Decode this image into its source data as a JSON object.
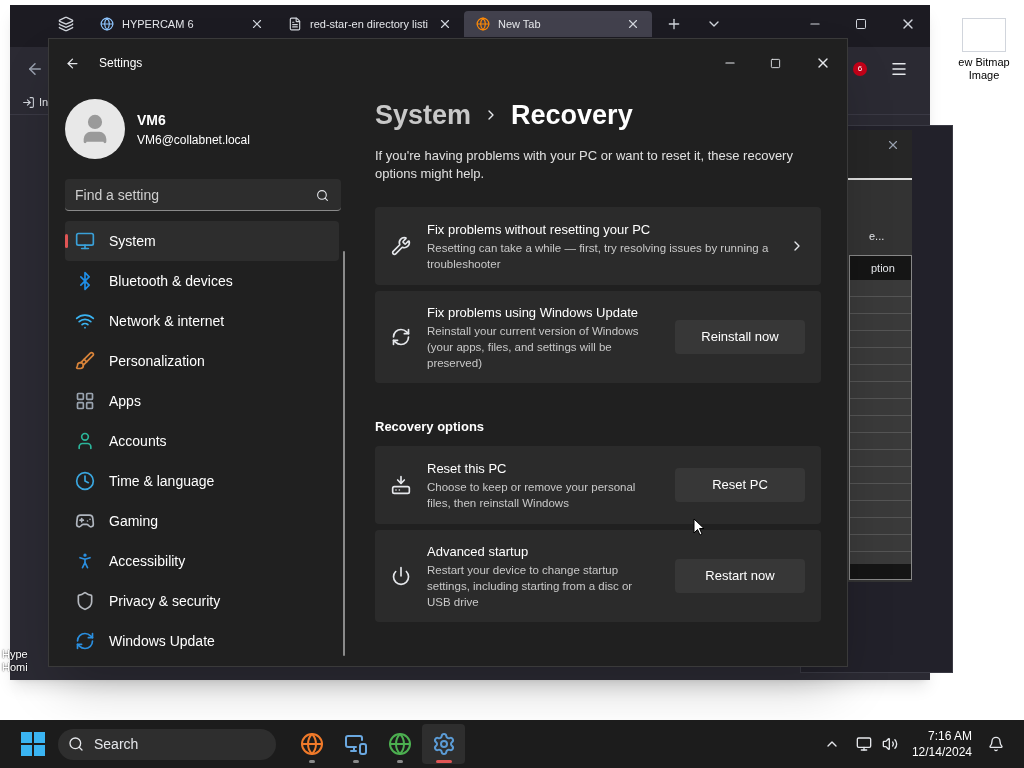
{
  "desktop": {
    "right_icon_label": "ew Bitmap Image",
    "left_icon_label": "Hype Homi"
  },
  "browser": {
    "tabs": [
      {
        "title": "HYPERCAM 6",
        "selected": false
      },
      {
        "title": "red-star-en directory listi",
        "selected": false
      },
      {
        "title": "New Tab",
        "selected": true
      }
    ],
    "badge": "6",
    "bookmark": "In"
  },
  "background_dialog": {
    "text": "e...",
    "column_header": "ption"
  },
  "settings": {
    "title": "Settings",
    "user": {
      "name": "VM6",
      "email": "VM6@collabnet.local"
    },
    "search": {
      "placeholder": "Find a setting"
    },
    "nav": [
      {
        "label": "System",
        "selected": true
      },
      {
        "label": "Bluetooth & devices",
        "selected": false
      },
      {
        "label": "Network & internet",
        "selected": false
      },
      {
        "label": "Personalization",
        "selected": false
      },
      {
        "label": "Apps",
        "selected": false
      },
      {
        "label": "Accounts",
        "selected": false
      },
      {
        "label": "Time & language",
        "selected": false
      },
      {
        "label": "Gaming",
        "selected": false
      },
      {
        "label": "Accessibility",
        "selected": false
      },
      {
        "label": "Privacy & security",
        "selected": false
      },
      {
        "label": "Windows Update",
        "selected": false
      }
    ],
    "breadcrumb": {
      "parent": "System",
      "current": "Recovery"
    },
    "description": "If you're having problems with your PC or want to reset it, these recovery options might help.",
    "cards": [
      {
        "kind": "link",
        "title": "Fix problems without resetting your PC",
        "description": "Resetting can take a while — first, try resolving issues by running a troubleshooter"
      },
      {
        "kind": "button",
        "title": "Fix problems using Windows Update",
        "description": "Reinstall your current version of Windows (your apps, files, and settings will be preserved)",
        "button": "Reinstall now"
      }
    ],
    "section_title": "Recovery options",
    "options": [
      {
        "kind": "button",
        "title": "Reset this PC",
        "description": "Choose to keep or remove your personal files, then reinstall Windows",
        "button": "Reset PC"
      },
      {
        "kind": "button",
        "title": "Advanced startup",
        "description": "Restart your device to change startup settings, including starting from a disc or USB drive",
        "button": "Restart now"
      }
    ]
  },
  "taskbar": {
    "search": "Search",
    "apps": [
      {
        "selected": false
      },
      {
        "selected": false
      },
      {
        "selected": false
      },
      {
        "selected": true
      }
    ],
    "time": "7:16 AM",
    "date": "12/14/2024"
  }
}
